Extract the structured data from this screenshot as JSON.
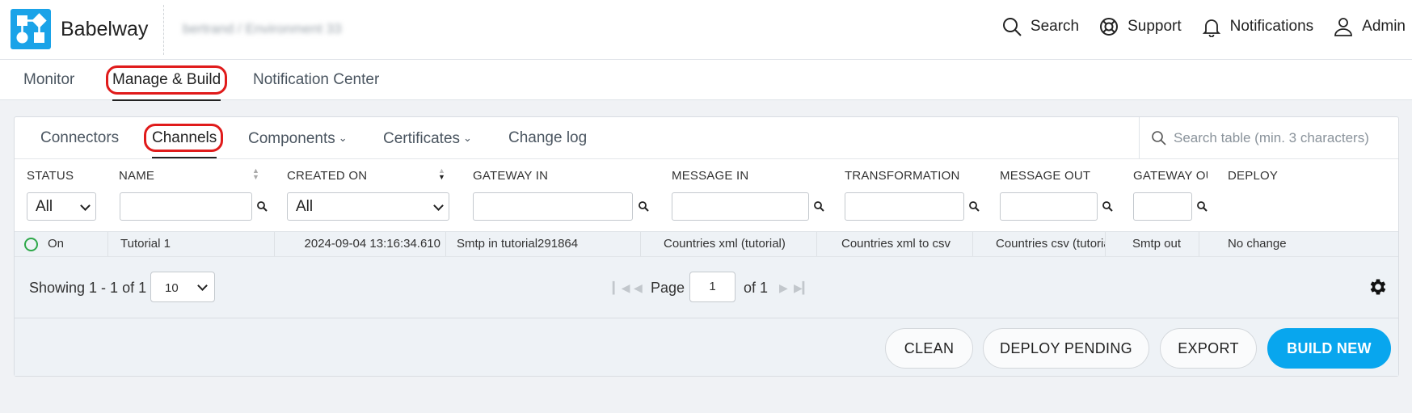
{
  "header": {
    "brand": "Babelway",
    "environment": "bertrand / Environment 33",
    "actions": [
      {
        "label": "Search",
        "icon": "search-icon"
      },
      {
        "label": "Support",
        "icon": "lifebuoy-icon"
      },
      {
        "label": "Notifications",
        "icon": "bell-icon"
      },
      {
        "label": "Admin",
        "icon": "user-icon"
      }
    ]
  },
  "main_nav": {
    "tabs": [
      {
        "label": "Monitor",
        "active": false
      },
      {
        "label": "Manage & Build",
        "active": true
      },
      {
        "label": "Notification Center",
        "active": false
      }
    ]
  },
  "sub_nav": {
    "tabs": [
      {
        "label": "Connectors",
        "active": false
      },
      {
        "label": "Channels",
        "active": true
      },
      {
        "label": "Components",
        "active": false,
        "dropdown": true
      },
      {
        "label": "Certificates",
        "active": false,
        "dropdown": true
      },
      {
        "label": "Change log",
        "active": false
      }
    ],
    "search_placeholder": "Search table (min. 3 characters)"
  },
  "table": {
    "columns": [
      "STATUS",
      "NAME",
      "CREATED ON",
      "GATEWAY IN",
      "MESSAGE IN",
      "TRANSFORMATION",
      "MESSAGE OUT",
      "GATEWAY OUT",
      "DEPLOY"
    ],
    "filters": {
      "status": "All",
      "created_on": "All"
    },
    "rows": [
      {
        "status": "On",
        "name": "Tutorial 1",
        "created_on": "2024-09-04 13:16:34.610",
        "gateway_in": "Smtp in tutorial291864",
        "message_in": "Countries xml (tutorial)",
        "transformation": "Countries xml to csv",
        "message_out": "Countries csv (tutorial)",
        "gateway_out": "Smtp out",
        "deploy": "No change"
      }
    ]
  },
  "pager": {
    "showing": "Showing 1 - 1 of 1",
    "per_page": "10",
    "page_label": "Page",
    "current_page": "1",
    "of_label": "of 1"
  },
  "footer": {
    "buttons": [
      "CLEAN",
      "DEPLOY PENDING",
      "EXPORT",
      "BUILD NEW"
    ]
  },
  "colors": {
    "accent": "#08a6ee",
    "highlight_ring": "#e01b1b",
    "status_on": "#2ea84a"
  }
}
